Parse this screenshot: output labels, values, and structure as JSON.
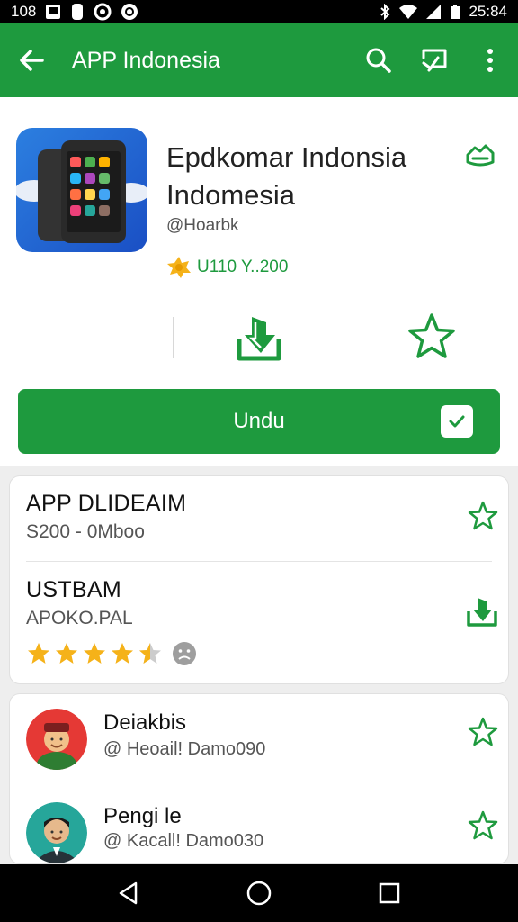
{
  "status_bar": {
    "time_left": "108",
    "time_right": "25:84"
  },
  "app_bar": {
    "title": "APP Indonesia",
    "back_icon": "arrow-left-icon",
    "search_icon": "search-icon",
    "cast_icon": "cast-icon",
    "more_icon": "more-vert-icon"
  },
  "app": {
    "name": "Epdkomar Indonsia Indomesia",
    "developer": "@Hoarbk",
    "rating_text": "U110 Y..200",
    "install_button_label": "Undu"
  },
  "colors": {
    "primary": "#1e9a3e",
    "star": "#f5b219"
  },
  "card1": {
    "row1": {
      "title": "APP DLIDEAIM",
      "subtitle": "S200 - 0Mboo"
    },
    "row2": {
      "title": "USTBAM",
      "subtitle": "APOKO.PAL",
      "rating": 4.5,
      "rating_max": 5
    }
  },
  "people": [
    {
      "name": "Deiakbis",
      "handle": "@ Heoail! Damo090"
    },
    {
      "name": "Pengi le",
      "handle": "@ Kacall! Damo030"
    }
  ]
}
